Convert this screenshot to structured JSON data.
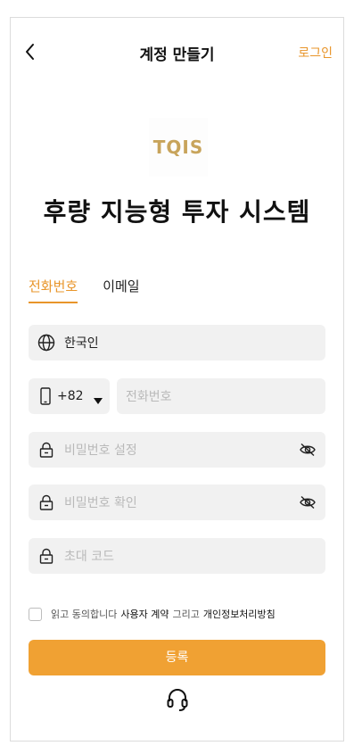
{
  "header": {
    "title": "계정 만들기",
    "login_label": "로그인"
  },
  "logo": {
    "text": "TQIS"
  },
  "hero": {
    "title": "후량 지능형 투자 시스템"
  },
  "tabs": [
    {
      "label": "전화번호",
      "active": true
    },
    {
      "label": "이메일",
      "active": false
    }
  ],
  "form": {
    "country": {
      "value": "한국인"
    },
    "country_code": {
      "value": "+82"
    },
    "phone": {
      "placeholder": "전화번호"
    },
    "password": {
      "placeholder": "비밀번호 설정"
    },
    "password_confirm": {
      "placeholder": "비밀번호 확인"
    },
    "invite_code": {
      "placeholder": "초대 코드"
    }
  },
  "agreement": {
    "prefix": "읽고 동의합니다",
    "terms": "사용자 계약",
    "joiner": "그리고",
    "privacy": "개인정보처리방침"
  },
  "submit": {
    "label": "등록"
  },
  "colors": {
    "accent": "#f0a133",
    "brand_gold": "#c8a45b",
    "field_bg": "#f1f1f1"
  },
  "icons": [
    "back-arrow-icon",
    "globe-icon",
    "phone-icon",
    "lock-icon",
    "eye-off-icon",
    "headset-icon"
  ]
}
